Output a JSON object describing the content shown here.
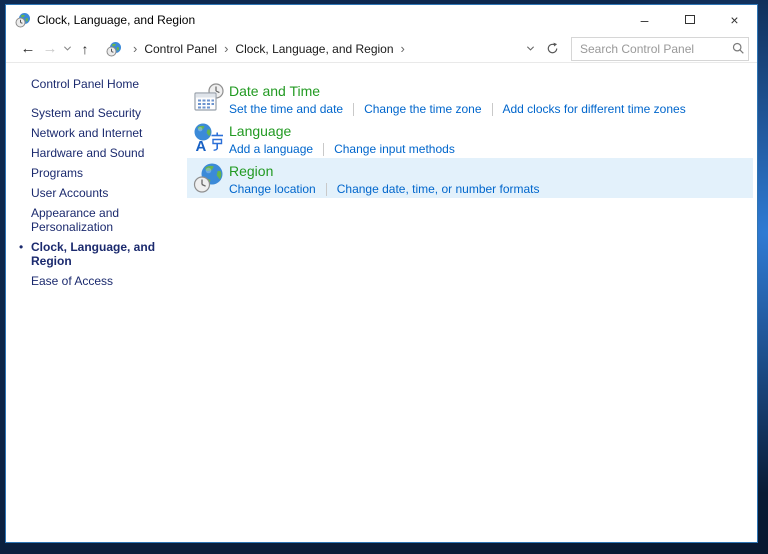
{
  "window": {
    "title": "Clock, Language, and Region",
    "controls": {
      "minimize": "–",
      "close": "×"
    }
  },
  "navbar": {
    "back": "←",
    "forward": "→",
    "up": "↑",
    "breadcrumb": {
      "separator": "›",
      "items": [
        "Control Panel",
        "Clock, Language, and Region"
      ]
    },
    "search": {
      "placeholder": "Search Control Panel"
    }
  },
  "sidebar": {
    "home_label": "Control Panel Home",
    "active_bullet": "•",
    "items": [
      {
        "label": "System and Security",
        "active": false
      },
      {
        "label": "Network and Internet",
        "active": false
      },
      {
        "label": "Hardware and Sound",
        "active": false
      },
      {
        "label": "Programs",
        "active": false
      },
      {
        "label": "User Accounts",
        "active": false
      },
      {
        "label": "Appearance and Personalization",
        "active": false
      },
      {
        "label": "Clock, Language, and Region",
        "active": true
      },
      {
        "label": "Ease of Access",
        "active": false
      }
    ]
  },
  "main": {
    "sections": [
      {
        "icon": "date-time-icon",
        "title": "Date and Time",
        "links": [
          "Set the time and date",
          "Change the time zone",
          "Add clocks for different time zones"
        ],
        "highlighted": false
      },
      {
        "icon": "language-icon",
        "title": "Language",
        "links": [
          "Add a language",
          "Change input methods"
        ],
        "highlighted": false
      },
      {
        "icon": "region-icon",
        "title": "Region",
        "links": [
          "Change location",
          "Change date, time, or number formats"
        ],
        "highlighted": true
      }
    ]
  },
  "colors": {
    "heading_green": "#229a22",
    "link_blue": "#0066cc",
    "sidebar_navy": "#1b2a6e",
    "highlight_blue": "#e3f1fb",
    "window_border": "#2e75b5"
  }
}
